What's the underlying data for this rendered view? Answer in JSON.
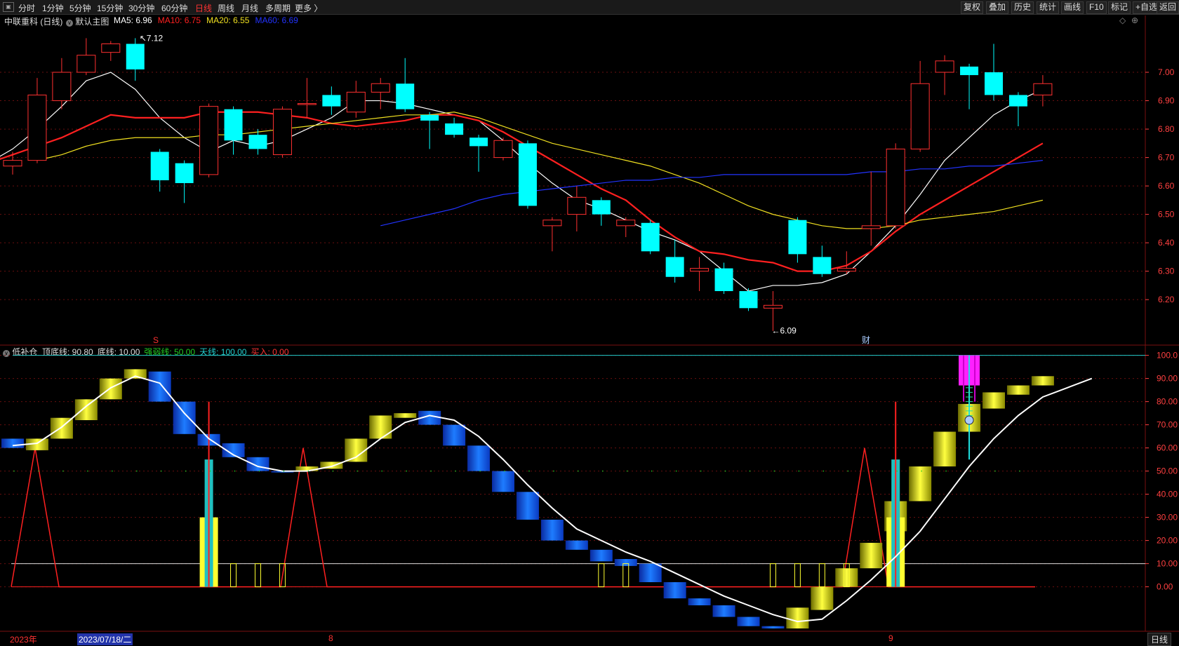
{
  "toolbar": {
    "periods": [
      "分时",
      "1分钟",
      "5分钟",
      "15分钟",
      "30分钟",
      "60分钟",
      "日线",
      "周线",
      "月线",
      "多周期",
      "更多 〉"
    ],
    "active_period": "日线",
    "right_buttons": [
      "复权",
      "叠加",
      "历史",
      "统计",
      "画线",
      "F10",
      "标记",
      "+自选",
      "返回"
    ]
  },
  "main": {
    "stock": "中联重科 (日线)",
    "template": "默认主图",
    "ma": [
      {
        "label": "MA5: 6.96",
        "color": "#ffffff"
      },
      {
        "label": "MA10: 6.75",
        "color": "#ff2020"
      },
      {
        "label": "MA20: 6.55",
        "color": "#f0e020"
      },
      {
        "label": "MA60: 6.69",
        "color": "#2233ff"
      }
    ],
    "high_label": "7.12",
    "low_label": "6.09",
    "s_marker": "S",
    "cai_marker": "财"
  },
  "indicator": {
    "name": "低补仓",
    "params": [
      {
        "label": "顶底线: 90.80",
        "color": "#dddddd"
      },
      {
        "label": "底线: 10.00",
        "color": "#dddddd"
      },
      {
        "label": "强弱线: 50.00",
        "color": "#22cc22"
      },
      {
        "label": "天线: 100.00",
        "color": "#22cccc"
      },
      {
        "label": "买入: 0.00",
        "color": "#ff3333"
      }
    ]
  },
  "footer": {
    "year": "2023年",
    "cursor_date": "2023/07/18/二",
    "month_aug": "8",
    "month_sep": "9",
    "period_button": "日线"
  },
  "chart_data": [
    {
      "type": "candlestick",
      "title": "中联重科 (日线)",
      "yticks": [
        "7.00",
        "6.90",
        "6.80",
        "6.70",
        "6.60",
        "6.50",
        "6.40",
        "6.30",
        "6.20"
      ],
      "ylim": [
        6.04,
        7.2
      ],
      "candles": [
        {
          "o": 6.67,
          "c": 6.69,
          "h": 6.72,
          "l": 6.64
        },
        {
          "o": 6.69,
          "c": 6.92,
          "h": 6.98,
          "l": 6.68
        },
        {
          "o": 6.9,
          "c": 7.0,
          "h": 7.05,
          "l": 6.87
        },
        {
          "o": 7.0,
          "c": 7.06,
          "h": 7.12,
          "l": 6.99
        },
        {
          "o": 7.07,
          "c": 7.1,
          "h": 7.11,
          "l": 7.04
        },
        {
          "o": 7.1,
          "c": 7.01,
          "h": 7.12,
          "l": 6.97
        },
        {
          "o": 6.72,
          "c": 6.62,
          "h": 6.73,
          "l": 6.58
        },
        {
          "o": 6.68,
          "c": 6.61,
          "h": 6.69,
          "l": 6.54
        },
        {
          "o": 6.64,
          "c": 6.88,
          "h": 6.89,
          "l": 6.63
        },
        {
          "o": 6.87,
          "c": 6.76,
          "h": 6.88,
          "l": 6.71
        },
        {
          "o": 6.78,
          "c": 6.73,
          "h": 6.8,
          "l": 6.71
        },
        {
          "o": 6.71,
          "c": 6.87,
          "h": 6.88,
          "l": 6.7
        },
        {
          "o": 6.89,
          "c": 6.89,
          "h": 6.98,
          "l": 6.84
        },
        {
          "o": 6.92,
          "c": 6.88,
          "h": 6.95,
          "l": 6.85
        },
        {
          "o": 6.86,
          "c": 6.93,
          "h": 6.97,
          "l": 6.84
        },
        {
          "o": 6.93,
          "c": 6.96,
          "h": 6.98,
          "l": 6.87
        },
        {
          "o": 6.96,
          "c": 6.87,
          "h": 7.05,
          "l": 6.86
        },
        {
          "o": 6.85,
          "c": 6.83,
          "h": 6.86,
          "l": 6.73
        },
        {
          "o": 6.82,
          "c": 6.78,
          "h": 6.84,
          "l": 6.77
        },
        {
          "o": 6.77,
          "c": 6.74,
          "h": 6.78,
          "l": 6.65
        },
        {
          "o": 6.7,
          "c": 6.76,
          "h": 6.77,
          "l": 6.69
        },
        {
          "o": 6.75,
          "c": 6.53,
          "h": 6.76,
          "l": 6.52
        },
        {
          "o": 6.46,
          "c": 6.48,
          "h": 6.49,
          "l": 6.37
        },
        {
          "o": 6.5,
          "c": 6.56,
          "h": 6.6,
          "l": 6.44
        },
        {
          "o": 6.55,
          "c": 6.5,
          "h": 6.56,
          "l": 6.46
        },
        {
          "o": 6.46,
          "c": 6.48,
          "h": 6.49,
          "l": 6.42
        },
        {
          "o": 6.47,
          "c": 6.37,
          "h": 6.48,
          "l": 6.36
        },
        {
          "o": 6.35,
          "c": 6.28,
          "h": 6.41,
          "l": 6.26
        },
        {
          "o": 6.3,
          "c": 6.31,
          "h": 6.35,
          "l": 6.23
        },
        {
          "o": 6.31,
          "c": 6.23,
          "h": 6.33,
          "l": 6.22
        },
        {
          "o": 6.23,
          "c": 6.17,
          "h": 6.24,
          "l": 6.16
        },
        {
          "o": 6.17,
          "c": 6.18,
          "h": 6.23,
          "l": 6.09
        },
        {
          "o": 6.48,
          "c": 6.36,
          "h": 6.49,
          "l": 6.33
        },
        {
          "o": 6.35,
          "c": 6.29,
          "h": 6.39,
          "l": 6.28
        },
        {
          "o": 6.3,
          "c": 6.31,
          "h": 6.37,
          "l": 6.29
        },
        {
          "o": 6.45,
          "c": 6.46,
          "h": 6.65,
          "l": 6.39
        },
        {
          "o": 6.46,
          "c": 6.73,
          "h": 6.75,
          "l": 6.45
        },
        {
          "o": 6.73,
          "c": 6.96,
          "h": 7.04,
          "l": 6.72
        },
        {
          "o": 7.0,
          "c": 7.04,
          "h": 7.06,
          "l": 6.92
        },
        {
          "o": 7.02,
          "c": 6.99,
          "h": 7.03,
          "l": 6.87
        },
        {
          "o": 7.0,
          "c": 6.92,
          "h": 7.1,
          "l": 6.9
        },
        {
          "o": 6.92,
          "c": 6.88,
          "h": 6.93,
          "l": 6.81
        },
        {
          "o": 6.92,
          "c": 6.96,
          "h": 6.99,
          "l": 6.88
        }
      ],
      "series": [
        {
          "name": "MA5",
          "color": "#ffffff",
          "values": [
            6.68,
            6.73,
            6.8,
            6.88,
            6.97,
            7.0,
            6.94,
            6.84,
            6.77,
            6.72,
            6.76,
            6.74,
            6.76,
            6.8,
            6.84,
            6.9,
            6.9,
            6.89,
            6.87,
            6.85,
            6.83,
            6.76,
            6.68,
            6.61,
            6.55,
            6.52,
            6.48,
            6.44,
            6.41,
            6.37,
            6.3,
            6.23,
            6.25,
            6.25,
            6.26,
            6.29,
            6.37,
            6.46,
            6.57,
            6.69,
            6.77,
            6.85,
            6.9,
            6.94
          ]
        },
        {
          "name": "MA10",
          "color": "#ff2020",
          "values": [
            6.68,
            6.71,
            6.74,
            6.77,
            6.81,
            6.85,
            6.84,
            6.84,
            6.84,
            6.86,
            6.86,
            6.86,
            6.85,
            6.84,
            6.82,
            6.81,
            6.82,
            6.83,
            6.85,
            6.85,
            6.83,
            6.79,
            6.74,
            6.69,
            6.64,
            6.59,
            6.55,
            6.48,
            6.42,
            6.37,
            6.36,
            6.34,
            6.33,
            6.3,
            6.3,
            6.32,
            6.37,
            6.44,
            6.5,
            6.55,
            6.6,
            6.65,
            6.7,
            6.75
          ]
        },
        {
          "name": "MA20",
          "color": "#f0e020",
          "values": [
            6.69,
            6.71,
            6.74,
            6.76,
            6.77,
            6.77,
            6.77,
            6.78,
            6.78,
            6.79,
            6.8,
            6.81,
            6.82,
            6.83,
            6.84,
            6.85,
            6.85,
            6.86,
            6.84,
            6.81,
            6.78,
            6.75,
            6.73,
            6.71,
            6.69,
            6.67,
            6.64,
            6.61,
            6.57,
            6.53,
            6.5,
            6.48,
            6.46,
            6.45,
            6.45,
            6.46,
            6.48,
            6.49,
            6.5,
            6.51,
            6.53,
            6.55
          ]
        },
        {
          "name": "MA60",
          "color": "#2233ff",
          "values": [
            6.46,
            6.48,
            6.5,
            6.52,
            6.55,
            6.57,
            6.58,
            6.59,
            6.6,
            6.61,
            6.62,
            6.62,
            6.63,
            6.63,
            6.64,
            6.64,
            6.64,
            6.64,
            6.64,
            6.64,
            6.65,
            6.65,
            6.66,
            6.66,
            6.67,
            6.67,
            6.68,
            6.69
          ]
        }
      ]
    },
    {
      "type": "bar",
      "title": "低补仓",
      "yticks": [
        "100.0",
        "90.00",
        "80.00",
        "70.00",
        "60.00",
        "50.00",
        "40.00",
        "30.00",
        "20.00",
        "10.00",
        "0.00"
      ],
      "ylim": [
        -18,
        102
      ],
      "reference_lines": [
        {
          "name": "天线",
          "value": 100,
          "color": "#22cccc"
        },
        {
          "name": "底线",
          "value": 10,
          "color": "#dddddd"
        },
        {
          "name": "买入",
          "value": 0,
          "color": "#ff2020"
        }
      ],
      "trend_line": [
        61,
        62,
        69,
        78,
        86,
        91,
        88,
        75,
        64,
        57,
        52,
        50,
        50,
        52,
        56,
        64,
        71,
        74,
        72,
        65,
        55,
        44,
        34,
        25,
        20,
        15,
        11,
        6,
        1,
        -4,
        -8,
        -12,
        -15,
        -14,
        -6,
        3,
        13,
        24,
        38,
        52,
        64,
        74,
        82,
        86,
        90
      ],
      "bars": [
        {
          "from": 60,
          "to": 64,
          "color": "blue"
        },
        {
          "from": 59,
          "to": 64,
          "color": "yellow"
        },
        {
          "from": 64,
          "to": 73,
          "color": "yellow"
        },
        {
          "from": 72,
          "to": 81,
          "color": "yellow"
        },
        {
          "from": 81,
          "to": 90,
          "color": "yellow"
        },
        {
          "from": 90,
          "to": 94,
          "color": "yellow"
        },
        {
          "from": 80,
          "to": 93,
          "color": "blue"
        },
        {
          "from": 66,
          "to": 80,
          "color": "blue"
        },
        {
          "from": 61,
          "to": 66,
          "color": "blue"
        },
        {
          "from": 56,
          "to": 62,
          "color": "blue"
        },
        {
          "from": 50,
          "to": 56,
          "color": "blue"
        },
        {
          "from": 50,
          "to": 50,
          "color": "blue"
        },
        {
          "from": 50,
          "to": 52,
          "color": "yellow"
        },
        {
          "from": 51,
          "to": 54,
          "color": "yellow"
        },
        {
          "from": 54,
          "to": 64,
          "color": "yellow"
        },
        {
          "from": 64,
          "to": 74,
          "color": "yellow"
        },
        {
          "from": 73,
          "to": 75,
          "color": "yellow"
        },
        {
          "from": 70,
          "to": 76,
          "color": "blue"
        },
        {
          "from": 61,
          "to": 70,
          "color": "blue"
        },
        {
          "from": 50,
          "to": 61,
          "color": "blue"
        },
        {
          "from": 41,
          "to": 50,
          "color": "blue"
        },
        {
          "from": 29,
          "to": 41,
          "color": "blue"
        },
        {
          "from": 20,
          "to": 29,
          "color": "blue"
        },
        {
          "from": 16,
          "to": 20,
          "color": "blue"
        },
        {
          "from": 11,
          "to": 16,
          "color": "blue"
        },
        {
          "from": 9,
          "to": 12,
          "color": "blue"
        },
        {
          "from": 2,
          "to": 10,
          "color": "blue"
        },
        {
          "from": -5,
          "to": 2,
          "color": "blue"
        },
        {
          "from": -8,
          "to": -5,
          "color": "blue"
        },
        {
          "from": -13,
          "to": -8,
          "color": "blue"
        },
        {
          "from": -17,
          "to": -13,
          "color": "blue"
        },
        {
          "from": -18,
          "to": -17,
          "color": "blue"
        },
        {
          "from": -18,
          "to": -9,
          "color": "yellow"
        },
        {
          "from": -10,
          "to": 0,
          "color": "yellow"
        },
        {
          "from": 0,
          "to": 8,
          "color": "yellow"
        },
        {
          "from": 8,
          "to": 19,
          "color": "yellow"
        },
        {
          "from": 24,
          "to": 37,
          "color": "yellow"
        },
        {
          "from": 37,
          "to": 52,
          "color": "yellow"
        },
        {
          "from": 52,
          "to": 67,
          "color": "yellow"
        },
        {
          "from": 67,
          "to": 79,
          "color": "yellow"
        },
        {
          "from": 77,
          "to": 84,
          "color": "yellow"
        },
        {
          "from": 83,
          "to": 87,
          "color": "yellow"
        },
        {
          "from": 87,
          "to": 91,
          "color": "yellow"
        }
      ],
      "red_spikes": [
        {
          "peak": 60
        },
        {
          "peak": 60
        },
        {
          "peak": 60
        }
      ],
      "buy_signals": [
        {
          "height": 55
        },
        {
          "height": 55
        }
      ],
      "magenta_cluster": {
        "from": 87,
        "to": 100
      }
    }
  ]
}
